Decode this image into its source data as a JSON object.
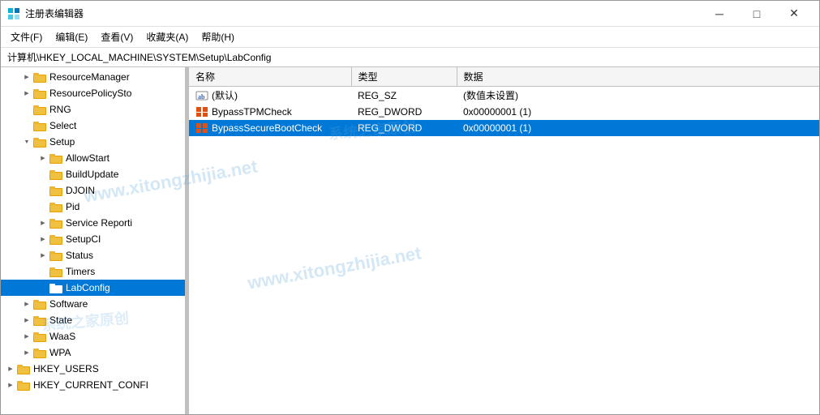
{
  "window": {
    "title": "注册表编辑器",
    "icon": "registry-editor-icon"
  },
  "titlebar": {
    "buttons": {
      "minimize": "─",
      "maximize": "□",
      "close": "✕"
    }
  },
  "menubar": {
    "items": [
      {
        "id": "file",
        "label": "文件(F)"
      },
      {
        "id": "edit",
        "label": "编辑(E)"
      },
      {
        "id": "view",
        "label": "查看(V)"
      },
      {
        "id": "favorites",
        "label": "收藏夹(A)"
      },
      {
        "id": "help",
        "label": "帮助(H)"
      }
    ]
  },
  "addressbar": {
    "label": "计算机\\HKEY_LOCAL_MACHINE\\SYSTEM\\Setup\\LabConfig"
  },
  "tree": {
    "items": [
      {
        "id": "resource-manager",
        "label": "ResourceManager",
        "level": 1,
        "expand": "collapsed",
        "selected": false
      },
      {
        "id": "resource-policy-sto",
        "label": "ResourcePolicySto",
        "level": 1,
        "expand": "collapsed",
        "selected": false
      },
      {
        "id": "rng",
        "label": "RNG",
        "level": 1,
        "expand": "empty",
        "selected": false
      },
      {
        "id": "select",
        "label": "Select",
        "level": 1,
        "expand": "empty",
        "selected": false
      },
      {
        "id": "setup",
        "label": "Setup",
        "level": 1,
        "expand": "expanded",
        "selected": false
      },
      {
        "id": "allowstart",
        "label": "AllowStart",
        "level": 2,
        "expand": "collapsed",
        "selected": false
      },
      {
        "id": "buildupdate",
        "label": "BuildUpdate",
        "level": 2,
        "expand": "empty",
        "selected": false
      },
      {
        "id": "djoin",
        "label": "DJOIN",
        "level": 2,
        "expand": "empty",
        "selected": false
      },
      {
        "id": "pid",
        "label": "Pid",
        "level": 2,
        "expand": "empty",
        "selected": false
      },
      {
        "id": "service-reporti",
        "label": "Service Reporti",
        "level": 2,
        "expand": "collapsed",
        "selected": false
      },
      {
        "id": "setupci",
        "label": "SetupCI",
        "level": 2,
        "expand": "collapsed",
        "selected": false
      },
      {
        "id": "status",
        "label": "Status",
        "level": 2,
        "expand": "collapsed",
        "selected": false
      },
      {
        "id": "timers",
        "label": "Timers",
        "level": 2,
        "expand": "empty",
        "selected": false
      },
      {
        "id": "labconfig",
        "label": "LabConfig",
        "level": 2,
        "expand": "empty",
        "selected": true
      },
      {
        "id": "software",
        "label": "Software",
        "level": 1,
        "expand": "collapsed",
        "selected": false
      },
      {
        "id": "state",
        "label": "State",
        "level": 1,
        "expand": "collapsed",
        "selected": false
      },
      {
        "id": "waas",
        "label": "WaaS",
        "level": 1,
        "expand": "collapsed",
        "selected": false
      },
      {
        "id": "wpa",
        "label": "WPA",
        "level": 1,
        "expand": "collapsed",
        "selected": false
      },
      {
        "id": "hkey-users",
        "label": "HKEY_USERS",
        "level": 0,
        "expand": "collapsed",
        "selected": false
      },
      {
        "id": "hkey-current-config",
        "label": "HKEY_CURRENT_CONFI",
        "level": 0,
        "expand": "collapsed",
        "selected": false
      }
    ]
  },
  "table": {
    "columns": [
      {
        "id": "name",
        "label": "名称"
      },
      {
        "id": "type",
        "label": "类型"
      },
      {
        "id": "data",
        "label": "数据"
      }
    ],
    "rows": [
      {
        "id": "default",
        "name": "(默认)",
        "type": "REG_SZ",
        "data": "(数值未设置)",
        "icon": "ab-icon"
      },
      {
        "id": "bypass-tpm",
        "name": "BypassTPMCheck",
        "type": "REG_DWORD",
        "data": "0x00000001 (1)",
        "icon": "dword-icon"
      },
      {
        "id": "bypass-secureboot",
        "name": "BypassSecureBootCheck",
        "type": "REG_DWORD",
        "data": "0x00000001 (1)",
        "icon": "dword-icon",
        "selected": true
      }
    ]
  },
  "watermark": {
    "text": "www.xitongzhijia.net"
  }
}
